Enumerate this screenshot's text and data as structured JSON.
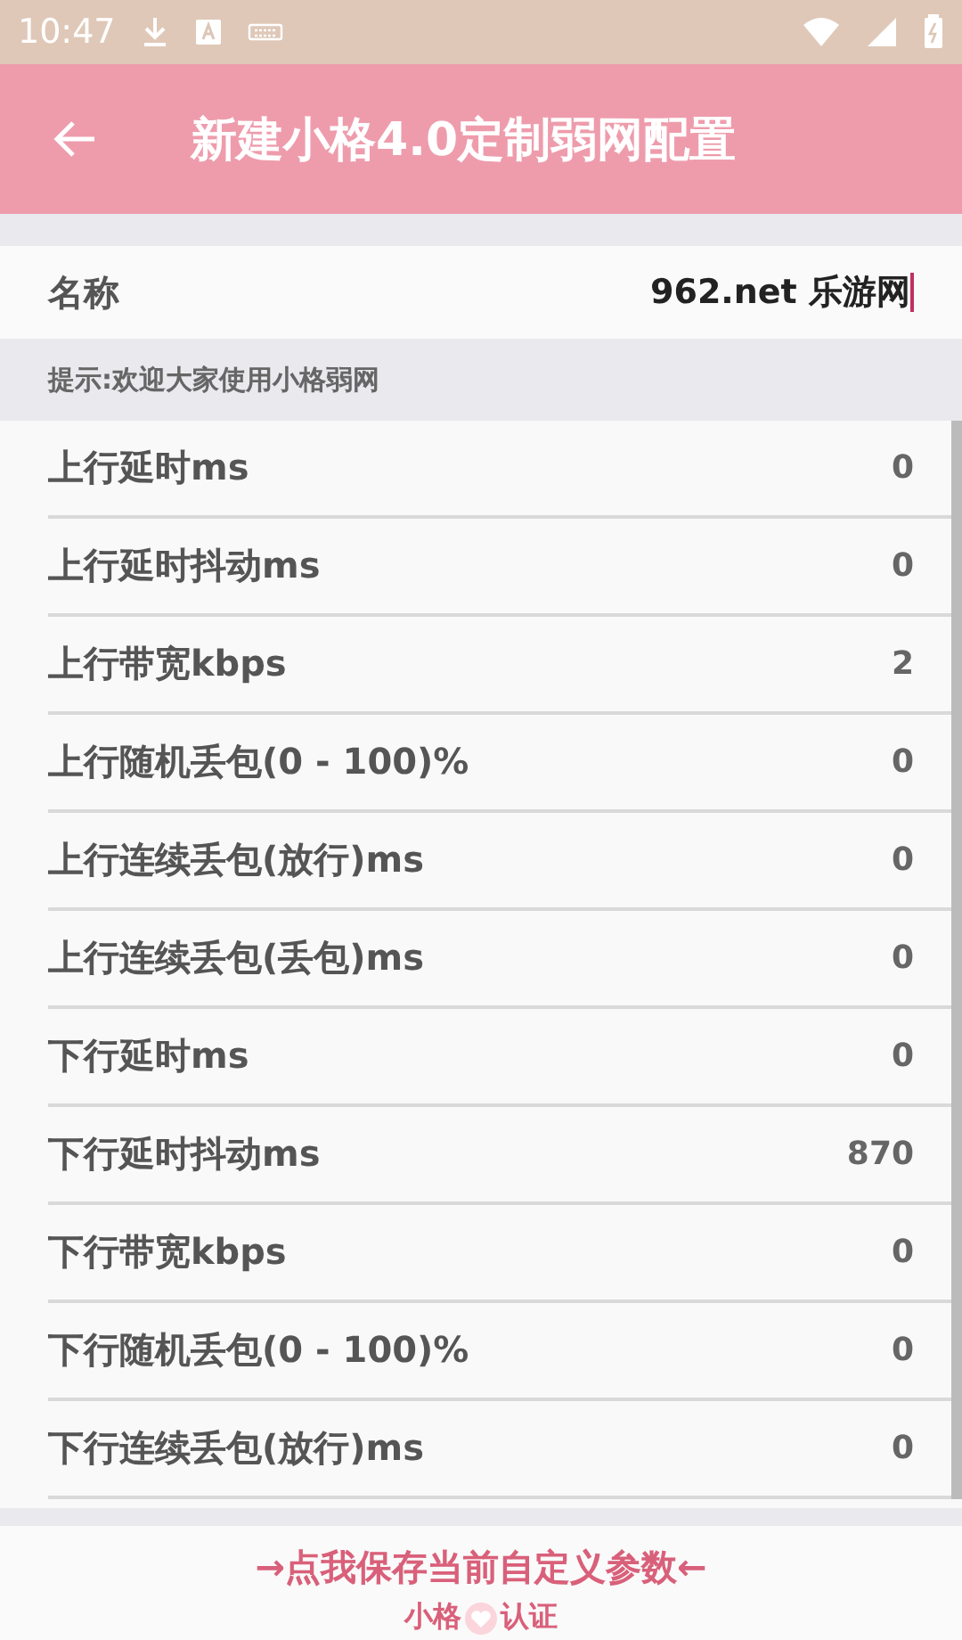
{
  "status_bar": {
    "time": "10:47"
  },
  "app_bar": {
    "title": "新建小格4.0定制弱网配置"
  },
  "name_field": {
    "label": "名称",
    "value": "962.net 乐游网"
  },
  "hint": "提示:欢迎大家使用小格弱网",
  "settings": [
    {
      "label": "上行延时ms",
      "value": "0"
    },
    {
      "label": "上行延时抖动ms",
      "value": "0"
    },
    {
      "label": "上行带宽kbps",
      "value": "2"
    },
    {
      "label": "上行随机丢包(0 - 100)%",
      "value": "0"
    },
    {
      "label": "上行连续丢包(放行)ms",
      "value": "0"
    },
    {
      "label": "上行连续丢包(丢包)ms",
      "value": "0"
    },
    {
      "label": "下行延时ms",
      "value": "0"
    },
    {
      "label": "下行延时抖动ms",
      "value": "870"
    },
    {
      "label": "下行带宽kbps",
      "value": "0"
    },
    {
      "label": "下行随机丢包(0 - 100)%",
      "value": "0"
    },
    {
      "label": "下行连续丢包(放行)ms",
      "value": "0"
    }
  ],
  "save_button": {
    "label": "→点我保存当前自定义参数←"
  },
  "certification": {
    "before": "小格",
    "after": "认证"
  }
}
